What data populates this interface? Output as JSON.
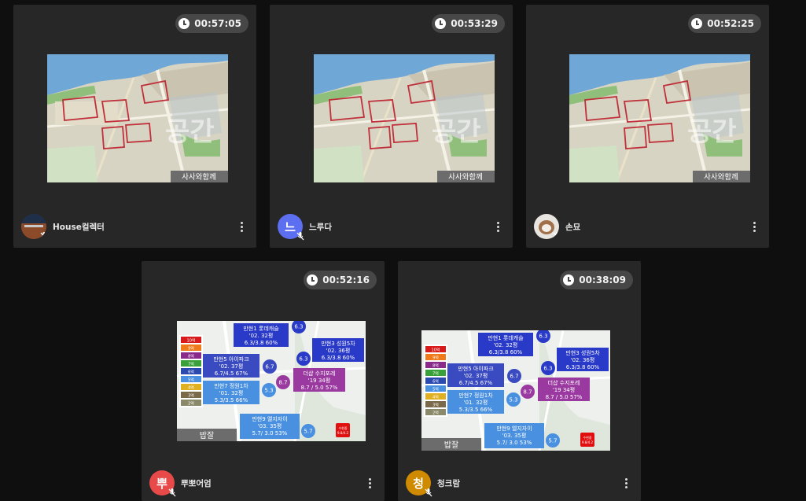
{
  "tiles": [
    {
      "timer": "00:57:05",
      "name": "House컬렉터",
      "map_caption": "사사와함께"
    },
    {
      "timer": "00:53:29",
      "name": "느루다",
      "avatar_text": "느",
      "map_caption": "사사와함께"
    },
    {
      "timer": "00:52:25",
      "name": "손묘",
      "map_caption": "사사와함께"
    },
    {
      "timer": "00:52:16",
      "name": "뿌뽀어엄",
      "avatar_text": "뿌"
    },
    {
      "timer": "00:38:09",
      "name": "청크람",
      "avatar_text": "청"
    }
  ],
  "colors": {
    "tile_bg": "#272727",
    "avatar_blue": "#5c6ff0",
    "avatar_red": "#e84a4a",
    "avatar_orange": "#cf8a00"
  },
  "price_map": {
    "caption": "밥잘",
    "legend": [
      "10억",
      "9억",
      "8억",
      "7억",
      "6억",
      "5억",
      "4억",
      "3억",
      "2억"
    ],
    "boxes": [
      {
        "lines": [
          "만현1 롯데캐슬",
          "'02. 32평",
          "6.3/3.8 60%"
        ]
      },
      {
        "lines": [
          "만현3 성원5차",
          "'02. 36평",
          "6.3/3.8 60%"
        ]
      },
      {
        "lines": [
          "만현5 아이파크",
          "'02. 37평",
          "6.7/4.5 67%"
        ]
      },
      {
        "lines": [
          "더샵 수지포레",
          "'19 34평",
          "8.7 / 5.0 57%"
        ]
      },
      {
        "lines": [
          "만현7 정원1차",
          "'01. 32평",
          "5.3/3.5 66%"
        ]
      },
      {
        "lines": [
          "만현9 엘지자이",
          "'03. 35평",
          "5.7/ 3.0 53%"
        ]
      }
    ],
    "bubbles": [
      "6.3",
      "6.3",
      "6.7",
      "8.7",
      "5.3",
      "5.7"
    ],
    "station": [
      "수현중",
      "9.8/4.2"
    ]
  }
}
